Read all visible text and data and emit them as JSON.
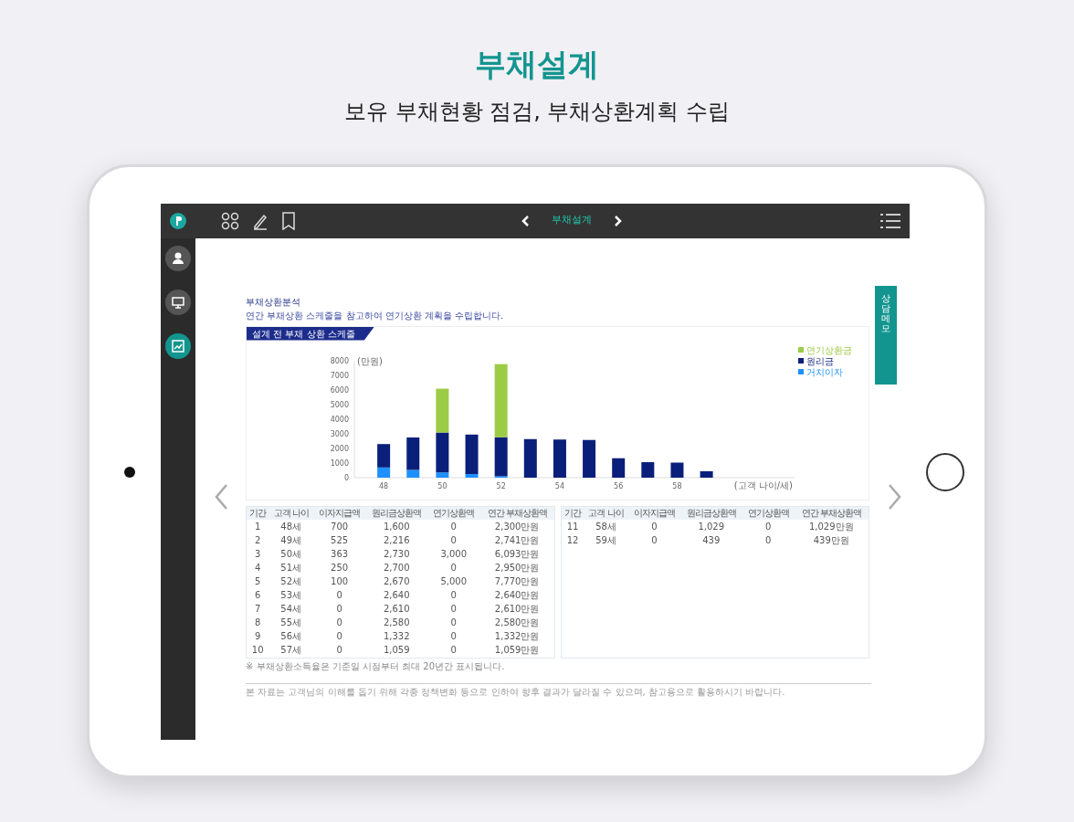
{
  "header": {
    "title": "부채설계",
    "subtitle": "보유 부채현황 점검, 부채상환계획 수립"
  },
  "app": {
    "topbar": {
      "title": "부채설계"
    },
    "rail": [
      {
        "selected": false
      },
      {
        "selected": false
      },
      {
        "selected": true
      }
    ],
    "side_tab": "상담메모",
    "section": {
      "label": "부채상환분석",
      "description": "연간 부채상환 스케줄을 참고하여 연기상환 계획을 수립합니다."
    },
    "chart_panel": {
      "title": "설계 전 부채 상환 스케줄",
      "chart_data": {
        "type": "bar",
        "stacked": true,
        "xlabel": "(고객 나이/세)",
        "ylabel": "(만원)",
        "x": [
          48,
          49,
          50,
          51,
          52,
          53,
          54,
          55,
          56,
          57,
          58,
          59
        ],
        "xticks": [
          48,
          50,
          52,
          54,
          56,
          58
        ],
        "xlim": [
          47,
          62
        ],
        "legend": true,
        "ylim": [
          0,
          8000
        ],
        "yticks": [
          0,
          1000,
          2000,
          3000,
          4000,
          5000,
          6000,
          7000,
          8000
        ],
        "series": [
          {
            "name": "거치이자",
            "color": "#1e90ff",
            "values": [
              700,
              530,
              360,
              250,
              100,
              0,
              0,
              0,
              0,
              0,
              0,
              0
            ]
          },
          {
            "name": "원리금",
            "color": "#0a1f7a",
            "values": [
              1600,
              2220,
              2730,
              2700,
              2670,
              2640,
              2610,
              2580,
              1330,
              1060,
              1030,
              440
            ]
          },
          {
            "name": "연기상환금",
            "color": "#9ccc45",
            "values": [
              0,
              0,
              3000,
              0,
              5000,
              0,
              0,
              0,
              0,
              0,
              0,
              0
            ]
          }
        ]
      }
    },
    "tables": [
      {
        "columns": [
          "기간",
          "고객 나이",
          "이자지급액",
          "원리금상환액",
          "연기상환액",
          "연간 부채상환액"
        ],
        "rows": [
          [
            "1",
            "48세",
            "700",
            "1,600",
            "0",
            "2,300만원"
          ],
          [
            "2",
            "49세",
            "525",
            "2,216",
            "0",
            "2,741만원"
          ],
          [
            "3",
            "50세",
            "363",
            "2,730",
            "3,000",
            "6,093만원"
          ],
          [
            "4",
            "51세",
            "250",
            "2,700",
            "0",
            "2,950만원"
          ],
          [
            "5",
            "52세",
            "100",
            "2,670",
            "5,000",
            "7,770만원"
          ],
          [
            "6",
            "53세",
            "0",
            "2,640",
            "0",
            "2,640만원"
          ],
          [
            "7",
            "54세",
            "0",
            "2,610",
            "0",
            "2,610만원"
          ],
          [
            "8",
            "55세",
            "0",
            "2,580",
            "0",
            "2,580만원"
          ],
          [
            "9",
            "56세",
            "0",
            "1,332",
            "0",
            "1,332만원"
          ],
          [
            "10",
            "57세",
            "0",
            "1,059",
            "0",
            "1,059만원"
          ]
        ]
      },
      {
        "columns": [
          "기간",
          "고객 나이",
          "이자지급액",
          "원리금상환액",
          "연기상환액",
          "연간 부채상환액"
        ],
        "rows": [
          [
            "11",
            "58세",
            "0",
            "1,029",
            "0",
            "1,029만원"
          ],
          [
            "12",
            "59세",
            "0",
            "439",
            "0",
            "439만원"
          ]
        ]
      }
    ],
    "table_note": "※ 부채상환소득율은 기준일 시점부터 최대 20년간 표시됩니다.",
    "disclaimer": "본 자료는 고객님의 이해를 돕기 위해 각종 정책변화 등으로 인하여 향후 결과가 달라질 수 있으며, 참고용으로 활용하시기 바랍니다."
  }
}
